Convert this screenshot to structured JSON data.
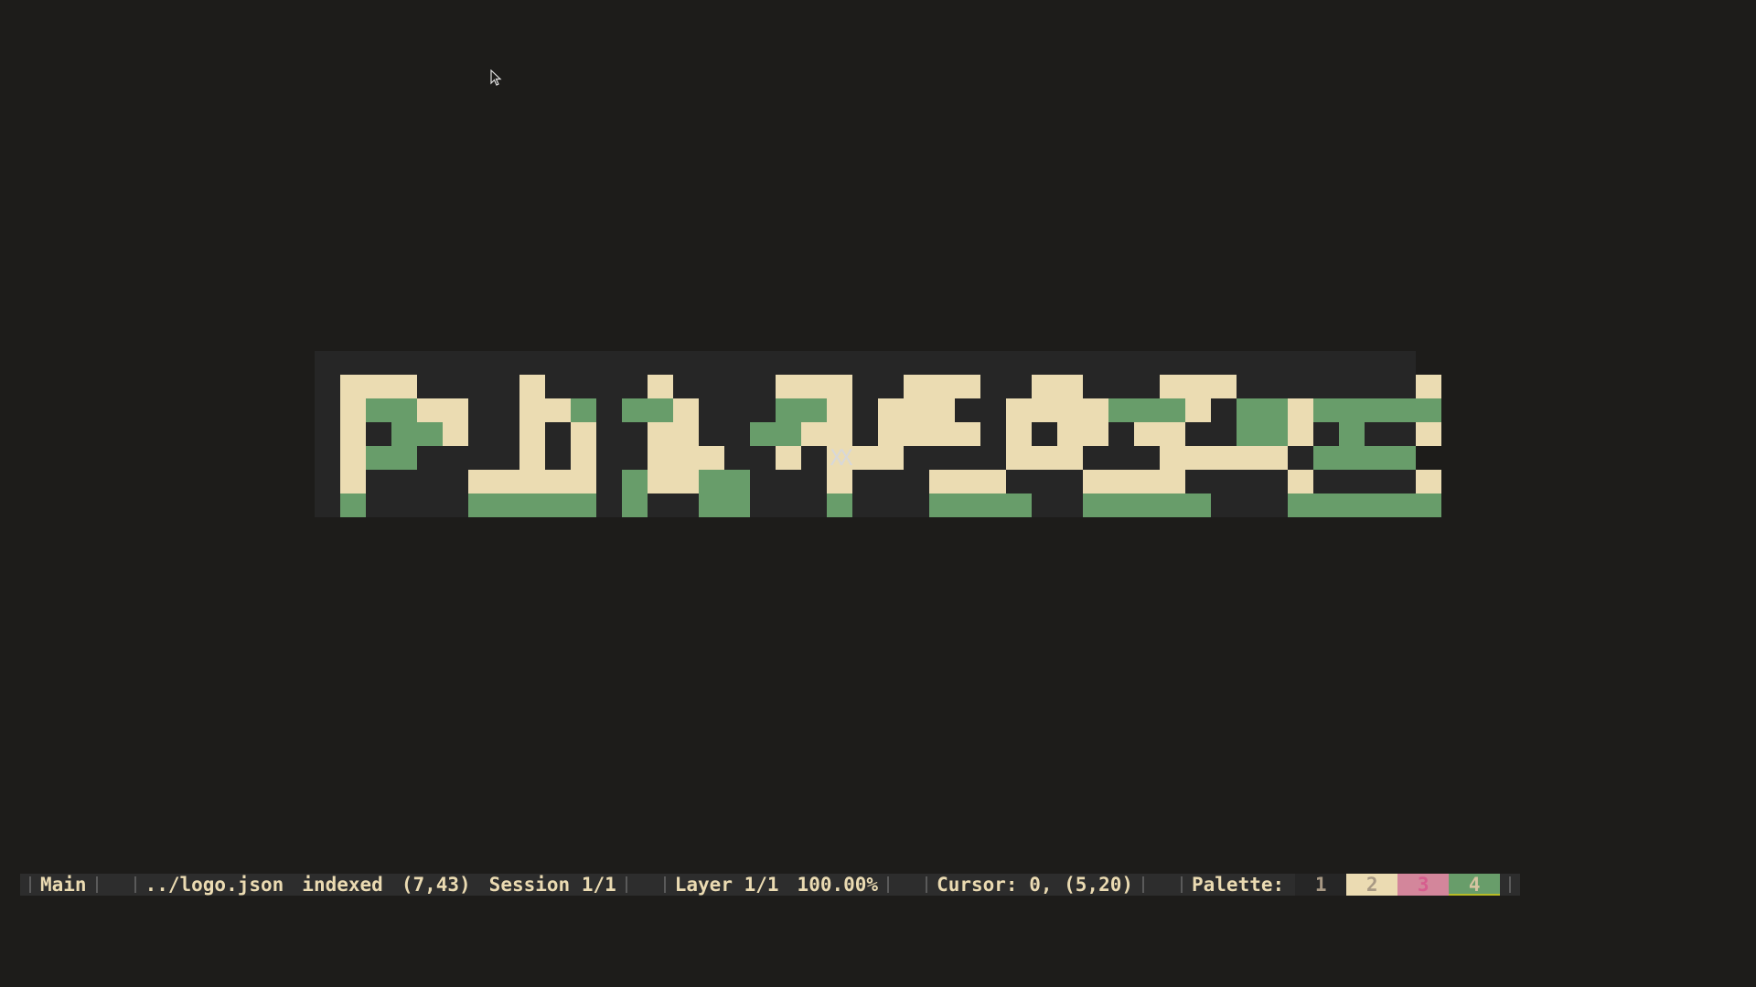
{
  "canvas": {
    "rows": 6,
    "cols": 43,
    "cursor_glyph": "XX",
    "pixels": [
      "2220050205002050022200222502205022200000002",
      "2442205224044205044202220022224442044244444",
      "2044205202052205442202222020220220044204002",
      "2440005202052220020222000022200022222044440",
      "2000022222042244000200022200022220000200002",
      "4000044444040044000400044440044444000444444"
    ]
  },
  "statusbar": {
    "mode": "Main",
    "file": "../logo.json",
    "color_mode": "indexed",
    "size": "(7,43)",
    "session": "Session 1/1",
    "layer": "Layer 1/1",
    "zoom": "100.00%",
    "cursor": "Cursor: 0, (5,20)",
    "palette_label": "Palette:",
    "palette": [
      {
        "label": "1",
        "color": "#262626"
      },
      {
        "label": "2",
        "color": "#ebdbb2"
      },
      {
        "label": "3",
        "color": "#d3869b"
      },
      {
        "label": "4",
        "color": "#689d6a"
      }
    ]
  }
}
